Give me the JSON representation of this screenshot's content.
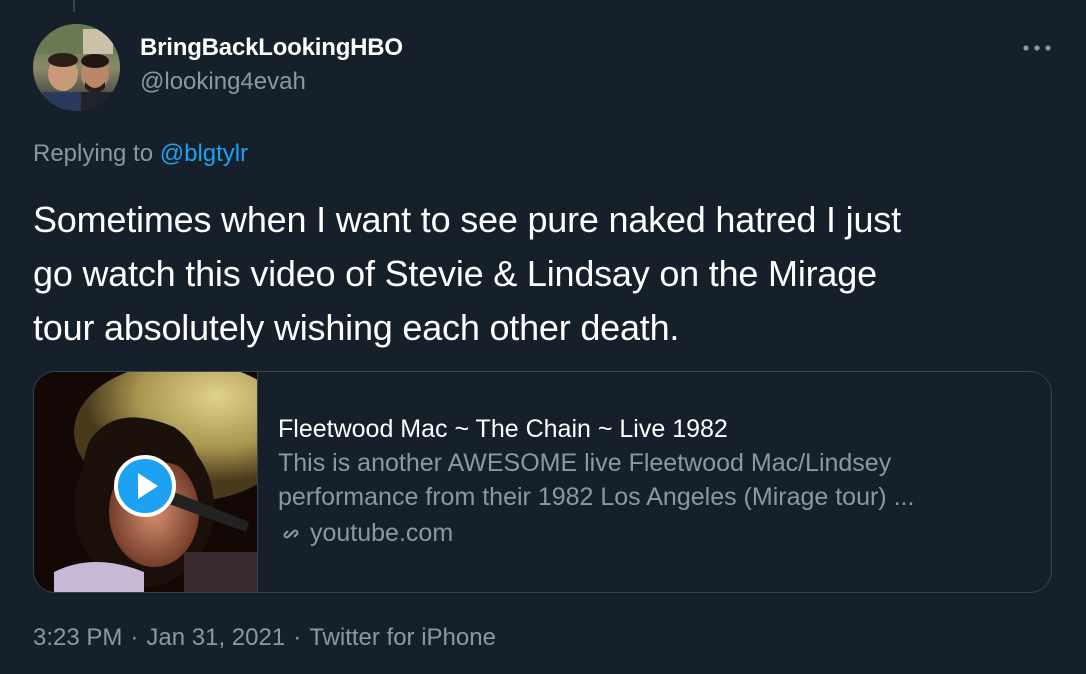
{
  "author": {
    "display_name": "BringBackLookingHBO",
    "handle": "@looking4evah"
  },
  "reply": {
    "prefix": "Replying to",
    "mention": "@blgtylr"
  },
  "tweet": {
    "text_lines": [
      "Sometimes when I want to see pure naked hatred I just",
      "go watch this video of Stevie & Lindsay on the Mirage",
      "tour absolutely wishing each other death."
    ]
  },
  "card": {
    "title": "Fleetwood Mac ~ The Chain ~ Live 1982",
    "description_lines": [
      "This is another AWESOME live Fleetwood Mac/Lindsey",
      "performance from their 1982 Los Angeles (Mirage tour) ..."
    ],
    "domain": "youtube.com",
    "thumbnail_icon": "play-icon"
  },
  "meta": {
    "time": "3:23 PM",
    "separator": "·",
    "date": "Jan 31, 2021",
    "source": "Twitter for iPhone"
  },
  "icons": {
    "more": "more-horizontal-icon",
    "link": "link-icon",
    "play": "play-icon"
  },
  "colors": {
    "background": "#15202b",
    "text_primary": "#ffffff",
    "text_secondary": "#8899a6",
    "accent": "#1da1f2",
    "border": "#38444d"
  }
}
